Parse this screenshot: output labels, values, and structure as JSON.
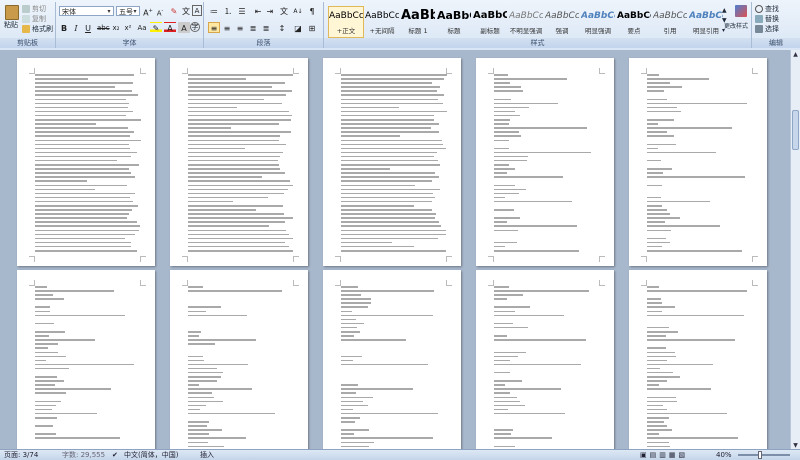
{
  "ribbon": {
    "clipboard": {
      "label": "剪贴板",
      "paste": "粘贴",
      "cut": "剪切",
      "copy": "复制",
      "format_painter": "格式刷"
    },
    "font": {
      "label": "字体",
      "font_name": "宋体",
      "font_size": "五号"
    },
    "paragraph": {
      "label": "段落"
    },
    "styles": {
      "label": "样式",
      "items": [
        {
          "sample": "AaBbCcDd",
          "name": "+正文"
        },
        {
          "sample": "AaBbCcDd",
          "name": "+无间隔"
        },
        {
          "sample": "AaBb",
          "name": "标题 1"
        },
        {
          "sample": "AaBbC",
          "name": "标题"
        },
        {
          "sample": "AaBbC",
          "name": "副标题"
        },
        {
          "sample": "AaBbCcD",
          "name": "不明显强调"
        },
        {
          "sample": "AaBbCcD",
          "name": "强调"
        },
        {
          "sample": "AaBbCcD",
          "name": "明显强调"
        },
        {
          "sample": "AaBbCcD",
          "name": "要点"
        },
        {
          "sample": "AaBbCcDd",
          "name": "引用"
        },
        {
          "sample": "AaBbCcDd",
          "name": "明显引用"
        }
      ],
      "change_styles": "更改样式"
    },
    "editing": {
      "label": "编辑",
      "find": "查找",
      "replace": "替换",
      "select": "选择"
    }
  },
  "status": {
    "page": "页面: 3/74",
    "words": "字数: 29,555",
    "language": "中文(简体，中国)",
    "mode": "插入",
    "zoom": "40%"
  },
  "colors": {
    "ribbon_bg": "#dbe7f6",
    "doc_bg": "#a8b8cc",
    "accent": "#fde7a3"
  }
}
